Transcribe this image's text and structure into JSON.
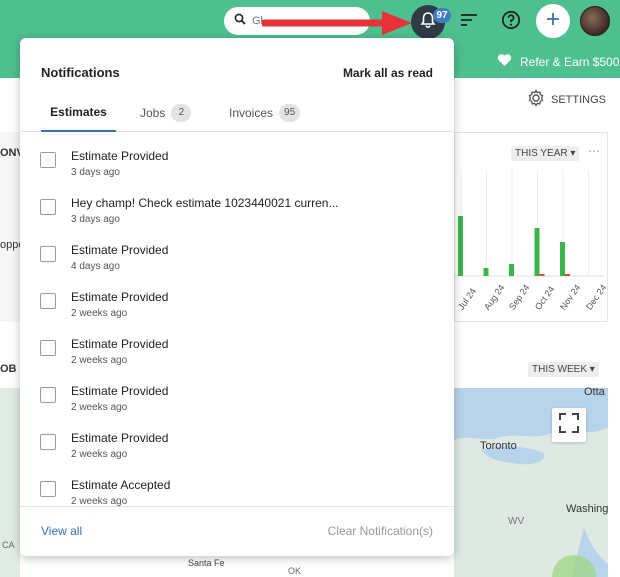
{
  "topbar": {
    "search_placeholder": "Gl",
    "notification_count": "97",
    "color": "#4ec08f"
  },
  "subbar": {
    "refer_label": "Refer & Earn $500"
  },
  "background": {
    "settings_label": "SETTINGS",
    "left_fragment_1": "ONV",
    "left_fragment_2": "oppo",
    "left_fragment_3": "OB",
    "chart_select": "THIS YEAR",
    "map_select": "THIS WEEK",
    "map_labels": {
      "ottawa": "Otta",
      "toronto": "Toronto",
      "washington": "Washing",
      "wv": "WV",
      "ca": "CA",
      "ok": "OK",
      "santa_fe": "Santa Fe"
    }
  },
  "chart_data": {
    "type": "bar",
    "categories": [
      "Jul 24",
      "Aug 24",
      "Sep 24",
      "Oct 24",
      "Nov 24",
      "Dec 24"
    ],
    "series": [
      {
        "values": [
          30,
          4,
          6,
          24,
          17,
          0
        ]
      },
      {
        "values": [
          0,
          0,
          0,
          1,
          1,
          0
        ]
      }
    ],
    "colors": [
      "#3bb54a",
      "#e84b3a"
    ]
  },
  "notifications": {
    "title": "Notifications",
    "mark_all": "Mark all as read",
    "tabs": [
      {
        "label": "Estimates",
        "count": ""
      },
      {
        "label": "Jobs",
        "count": "2"
      },
      {
        "label": "Invoices",
        "count": "95"
      }
    ],
    "items": [
      {
        "title": "Estimate Provided",
        "time": "3 days ago"
      },
      {
        "title": "Hey champ! Check estimate 1023440021 curren...",
        "time": "3 days ago"
      },
      {
        "title": "Estimate Provided",
        "time": "4 days ago"
      },
      {
        "title": "Estimate Provided",
        "time": "2 weeks ago"
      },
      {
        "title": "Estimate Provided",
        "time": "2 weeks ago"
      },
      {
        "title": "Estimate Provided",
        "time": "2 weeks ago"
      },
      {
        "title": "Estimate Provided",
        "time": "2 weeks ago"
      },
      {
        "title": "Estimate Accepted",
        "time": "2 weeks ago"
      }
    ],
    "view_all": "View all",
    "clear": "Clear Notification(s)"
  }
}
